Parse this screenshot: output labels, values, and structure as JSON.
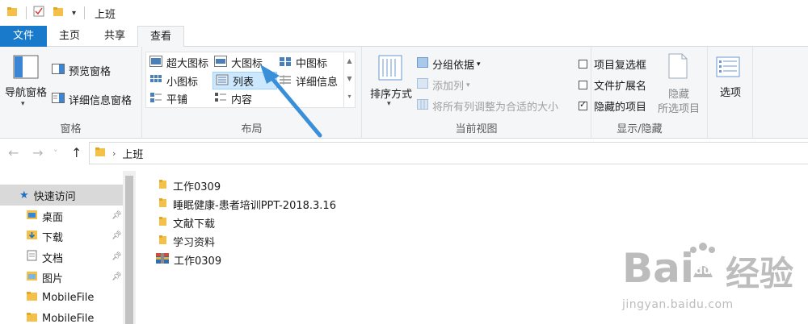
{
  "window": {
    "title": "上班"
  },
  "tabs": [
    {
      "label": "文件"
    },
    {
      "label": "主页"
    },
    {
      "label": "共享"
    },
    {
      "label": "查看"
    }
  ],
  "ribbon": {
    "panes": {
      "label": "窗格",
      "nav_pane": "导航窗格",
      "preview_pane": "预览窗格",
      "details_pane": "详细信息窗格"
    },
    "layout": {
      "label": "布局",
      "extra_large_icons": "超大图标",
      "large_icons": "大图标",
      "medium_icons": "中图标",
      "small_icons": "小图标",
      "list": "列表",
      "details": "详细信息",
      "tiles": "平铺",
      "content": "内容",
      "selected": "列表"
    },
    "current_view": {
      "label": "当前视图",
      "sort_by": "排序方式",
      "group_by": "分组依据",
      "add_columns": "添加列",
      "size_columns": "将所有列调整为合适的大小"
    },
    "show_hide": {
      "label": "显示/隐藏",
      "item_checkboxes": "项目复选框",
      "item_checkboxes_checked": false,
      "file_extensions": "文件扩展名",
      "file_extensions_checked": false,
      "hidden_items": "隐藏的项目",
      "hidden_items_checked": true,
      "hide_selected_1": "隐藏",
      "hide_selected_2": "所选项目"
    },
    "options": {
      "label": "选项"
    }
  },
  "address": {
    "breadcrumb": "上班"
  },
  "navigation": {
    "quick_access": "快速访问",
    "items": [
      {
        "label": "桌面",
        "icon": "desktop-folder-icon",
        "pinned": true
      },
      {
        "label": "下载",
        "icon": "download-folder-icon",
        "pinned": true
      },
      {
        "label": "文档",
        "icon": "document-folder-icon",
        "pinned": true
      },
      {
        "label": "图片",
        "icon": "pictures-folder-icon",
        "pinned": true
      },
      {
        "label": "MobileFile",
        "icon": "folder-icon",
        "pinned": false
      },
      {
        "label": "MobileFile",
        "icon": "folder-icon",
        "pinned": false
      }
    ]
  },
  "files": [
    {
      "name": "工作0309",
      "icon": "folder-icon"
    },
    {
      "name": "睡眠健康-患者培训PPT-2018.3.16",
      "icon": "folder-icon"
    },
    {
      "name": "文献下载",
      "icon": "folder-icon"
    },
    {
      "name": "学习资料",
      "icon": "folder-icon"
    },
    {
      "name": "工作0309",
      "icon": "archive-icon"
    }
  ],
  "watermark": {
    "brand": "Bai",
    "brand_du": "du",
    "cn": "经验",
    "url": "jingyan.baidu.com"
  },
  "colors": {
    "file_tab": "#1979ca",
    "selection": "#cce8ff",
    "folder": "#f3c14a",
    "arrow": "#3a8fd9"
  }
}
